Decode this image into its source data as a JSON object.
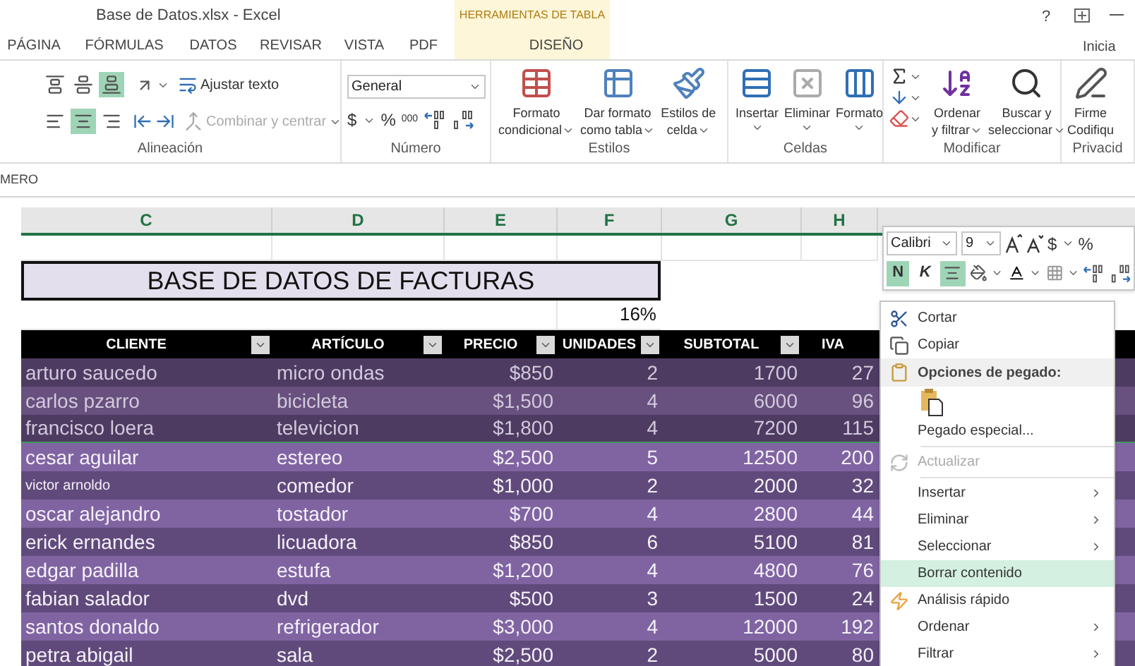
{
  "window": {
    "title": "Base de Datos.xlsx - Excel",
    "contextual_group": "HERRAMIENTAS DE TABLA",
    "help": "?",
    "account": "Inicia"
  },
  "ribbon_tabs": [
    {
      "label": "PÁGINA",
      "selected": false,
      "kind": "normal"
    },
    {
      "label": "FÓRMULAS",
      "selected": false,
      "kind": "normal"
    },
    {
      "label": "DATOS",
      "selected": false,
      "kind": "normal"
    },
    {
      "label": "REVISAR",
      "selected": false,
      "kind": "normal"
    },
    {
      "label": "VISTA",
      "selected": false,
      "kind": "normal"
    },
    {
      "label": "PDF",
      "selected": false,
      "kind": "normal"
    },
    {
      "label": "DISEÑO",
      "selected": false,
      "kind": "contextual"
    }
  ],
  "alignment_group": {
    "label": "Alineación",
    "buttons": [
      {
        "kind": "top",
        "selected": false
      },
      {
        "kind": "middle",
        "selected": false
      },
      {
        "kind": "bottom",
        "selected": true
      },
      {
        "kind": "left",
        "selected": false
      },
      {
        "kind": "center",
        "selected": true
      },
      {
        "kind": "right",
        "selected": false
      }
    ],
    "wrap_text": "Ajustar texto",
    "merge": {
      "label": "Combinar y centrar",
      "disabled": true
    }
  },
  "number_group": {
    "label": "Número",
    "format": "General",
    "currency": "$",
    "percent": "%",
    "thousands": "000"
  },
  "styles_group": {
    "label": "Estilos",
    "buttons": [
      {
        "kind": "conditional",
        "lines": [
          "Formato",
          "condicional"
        ]
      },
      {
        "kind": "table",
        "lines": [
          "Dar formato",
          "como tabla"
        ]
      },
      {
        "kind": "cell",
        "lines": [
          "Estilos de",
          "celda"
        ]
      }
    ]
  },
  "cells_group": {
    "label": "Celdas",
    "buttons": [
      {
        "kind": "insert",
        "label": "Insertar"
      },
      {
        "kind": "delete",
        "label": "Eliminar"
      },
      {
        "kind": "format",
        "label": "Formato"
      }
    ]
  },
  "editing_group": {
    "label": "Modificar",
    "buttons": [
      {
        "kind": "sort",
        "lines": [
          "Ordenar",
          "y filtrar"
        ]
      },
      {
        "kind": "find",
        "lines": [
          "Buscar y",
          "seleccionar"
        ]
      }
    ]
  },
  "privacy_group": {
    "label": "Privacid",
    "lines": [
      "Firme",
      "Codifiqu"
    ]
  },
  "name_box": "MERO",
  "columns": [
    {
      "label": "C",
      "selected": true
    },
    {
      "label": "D",
      "selected": true
    },
    {
      "label": "E",
      "selected": true
    },
    {
      "label": "F",
      "selected": true
    },
    {
      "label": "G",
      "selected": true
    },
    {
      "label": "H",
      "selected": true
    }
  ],
  "sheet_title": "BASE DE DATOS DE FACTURAS",
  "tax_rate": "16%",
  "table": {
    "columns": [
      "CLIENTE",
      "ARTÍCULO",
      "PRECIO",
      "UNIDADES",
      "SUBTOTAL",
      "IVA"
    ],
    "rows": [
      {
        "cells": [
          "arturo saucedo",
          "micro ondas",
          "$850",
          "2",
          "1700",
          "27"
        ],
        "selected": true,
        "small": false
      },
      {
        "cells": [
          "carlos pzarro",
          "bicicleta",
          "$1,500",
          "4",
          "6000",
          "96"
        ],
        "selected": true,
        "small": false
      },
      {
        "cells": [
          "francisco loera",
          "televicion",
          "$1,800",
          "4",
          "7200",
          "115"
        ],
        "selected": true,
        "small": false
      },
      {
        "cells": [
          "cesar aguilar",
          "estereo",
          "$2,500",
          "5",
          "12500",
          "200"
        ],
        "selected": false,
        "small": false
      },
      {
        "cells": [
          "victor arnoldo",
          "comedor",
          "$1,000",
          "2",
          "2000",
          "32"
        ],
        "selected": false,
        "small": true
      },
      {
        "cells": [
          "oscar alejandro",
          "tostador",
          "$700",
          "4",
          "2800",
          "44"
        ],
        "selected": false,
        "small": false
      },
      {
        "cells": [
          "erick ernandes",
          "licuadora",
          "$850",
          "6",
          "5100",
          "81"
        ],
        "selected": false,
        "small": false
      },
      {
        "cells": [
          "edgar padilla",
          "estufa",
          "$1,200",
          "4",
          "4800",
          "76"
        ],
        "selected": false,
        "small": false
      },
      {
        "cells": [
          "fabian salador",
          "dvd",
          "$500",
          "3",
          "1500",
          "24"
        ],
        "selected": false,
        "small": false
      },
      {
        "cells": [
          "santos donaldo",
          "refrigerador",
          "$3,000",
          "4",
          "12000",
          "192"
        ],
        "selected": false,
        "small": false
      },
      {
        "cells": [
          "petra abigail",
          "sala",
          "$2,500",
          "2",
          "5000",
          "80"
        ],
        "selected": false,
        "small": false
      }
    ]
  },
  "mini_toolbar": {
    "font": "Calibri",
    "size": "9",
    "currency": "$",
    "percent": "%",
    "bold": {
      "label": "N",
      "on": true
    },
    "italic": {
      "label": "K",
      "on": false
    },
    "center_on": true
  },
  "context_menu": [
    {
      "kind": "cut",
      "label": "Cortar",
      "disabled": false,
      "selected": false
    },
    {
      "kind": "copy",
      "label": "Copiar",
      "disabled": false,
      "selected": false
    },
    {
      "kind": "header",
      "label": "Opciones de pegado:"
    },
    {
      "kind": "paste"
    },
    {
      "kind": "item",
      "label": "Pegado especial...",
      "disabled": false,
      "selected": false
    },
    {
      "kind": "separator"
    },
    {
      "kind": "refresh",
      "label": "Actualizar",
      "disabled": true,
      "selected": false
    },
    {
      "kind": "separator"
    },
    {
      "kind": "submenu",
      "label": "Insertar",
      "disabled": false,
      "selected": false
    },
    {
      "kind": "submenu",
      "label": "Eliminar",
      "disabled": false,
      "selected": false
    },
    {
      "kind": "submenu",
      "label": "Seleccionar",
      "disabled": false,
      "selected": false
    },
    {
      "kind": "item",
      "label": "Borrar contenido",
      "disabled": false,
      "selected": true
    },
    {
      "kind": "quick",
      "label": "Análisis rápido",
      "disabled": false,
      "selected": false
    },
    {
      "kind": "submenu",
      "label": "Ordenar",
      "disabled": false,
      "selected": false
    },
    {
      "kind": "submenu",
      "label": "Filtrar",
      "disabled": false,
      "selected": false
    }
  ]
}
